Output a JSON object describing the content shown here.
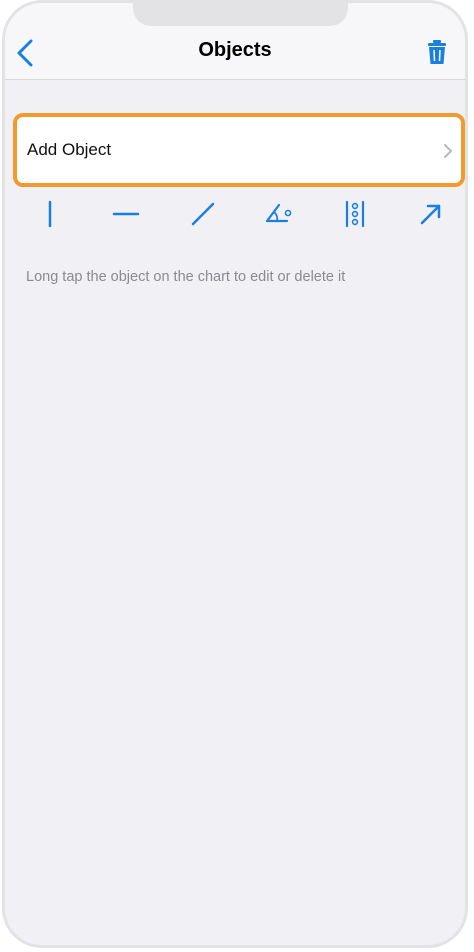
{
  "navbar": {
    "title": "Objects",
    "back_icon": "chevron-left-icon",
    "trash_icon": "trash-icon"
  },
  "add_object": {
    "label": "Add Object",
    "chevron_icon": "chevron-right-icon"
  },
  "tools": [
    {
      "name": "vertical-line-icon"
    },
    {
      "name": "horizontal-line-icon"
    },
    {
      "name": "trend-line-icon"
    },
    {
      "name": "angle-icon"
    },
    {
      "name": "fibonacci-levels-icon"
    },
    {
      "name": "arrow-icon"
    }
  ],
  "hint": "Long tap the object on the chart to edit or delete it",
  "colors": {
    "accent": "#1a7fdd",
    "highlight": "#f29a2e",
    "background": "#f0f0f5"
  }
}
